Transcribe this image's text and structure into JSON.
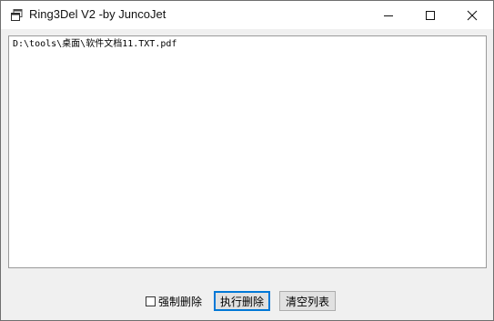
{
  "window": {
    "title": "Ring3Del V2 -by JuncoJet",
    "icon": "app-window-icon"
  },
  "titlebar_buttons": {
    "minimize": "minimize-icon",
    "maximize": "maximize-icon",
    "close": "close-icon"
  },
  "file_list": {
    "items": [
      "D:\\tools\\桌面\\软件文档11.TXT.pdf"
    ]
  },
  "controls": {
    "force_delete_label": "强制删除",
    "force_delete_checked": false,
    "execute_delete_label": "执行删除",
    "clear_list_label": "清空列表"
  },
  "colors": {
    "titlebar_bg": "#ffffff",
    "window_bg": "#f0f0f0",
    "list_bg": "#ffffff",
    "focus_border": "#0078d7"
  }
}
